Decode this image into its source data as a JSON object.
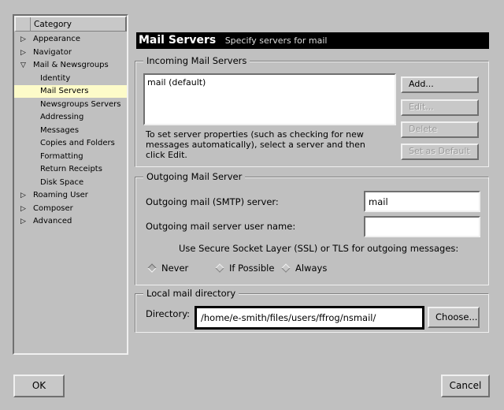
{
  "sidebar": {
    "header": "Category",
    "items": [
      {
        "label": "Appearance",
        "level": 0,
        "expander": "collapsed"
      },
      {
        "label": "Navigator",
        "level": 0,
        "expander": "collapsed"
      },
      {
        "label": "Mail & Newsgroups",
        "level": 0,
        "expander": "expanded"
      },
      {
        "label": "Identity",
        "level": 1
      },
      {
        "label": "Mail Servers",
        "level": 1,
        "selected": true
      },
      {
        "label": "Newsgroups Servers",
        "level": 1
      },
      {
        "label": "Addressing",
        "level": 1
      },
      {
        "label": "Messages",
        "level": 1
      },
      {
        "label": "Copies and Folders",
        "level": 1
      },
      {
        "label": "Formatting",
        "level": 1
      },
      {
        "label": "Return Receipts",
        "level": 1
      },
      {
        "label": "Disk Space",
        "level": 1
      },
      {
        "label": "Roaming User",
        "level": 0,
        "expander": "collapsed"
      },
      {
        "label": "Composer",
        "level": 0,
        "expander": "collapsed"
      },
      {
        "label": "Advanced",
        "level": 0,
        "expander": "collapsed"
      }
    ]
  },
  "header": {
    "title": "Mail Servers",
    "subtitle": "Specify servers for mail"
  },
  "incoming": {
    "label": "Incoming Mail Servers",
    "servers": [
      "mail (default)"
    ],
    "help": "To set server properties (such as checking for new messages automatically), select a server and then click Edit.",
    "add": "Add...",
    "edit": "Edit...",
    "delete": "Delete",
    "set_default": "Set as Default"
  },
  "outgoing": {
    "label": "Outgoing Mail Server",
    "smtp_label": "Outgoing mail (SMTP) server:",
    "smtp_value": "mail",
    "user_label": "Outgoing mail server user name:",
    "user_value": "",
    "ssl_label": "Use Secure Socket Layer (SSL) or TLS for outgoing messages:",
    "ssl_options": [
      "Never",
      "If Possible",
      "Always"
    ],
    "ssl_selected": "Never"
  },
  "local": {
    "label": "Local mail directory",
    "dir_label": "Directory:",
    "dir_value": "/home/e-smith/files/users/ffrog/nsmail/",
    "choose": "Choose..."
  },
  "footer": {
    "ok": "OK",
    "cancel": "Cancel"
  },
  "colors": {
    "selection": "#fdfbc9",
    "header_bg": "#000000"
  }
}
